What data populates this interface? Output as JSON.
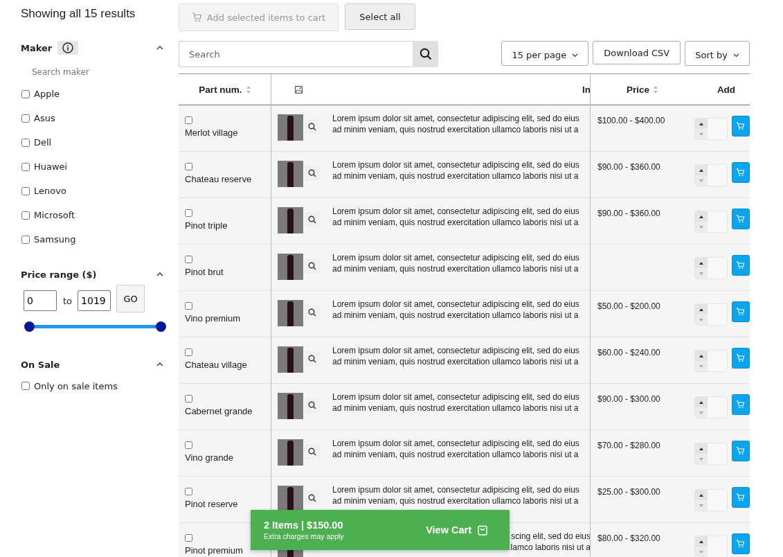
{
  "sidebar": {
    "results_title": "Showing all 15 results",
    "maker": {
      "title": "Maker",
      "expanded": true,
      "search": {
        "placeholder": "Search maker"
      },
      "options": [
        {
          "label": "Apple",
          "checked": false
        },
        {
          "label": "Asus",
          "checked": false
        },
        {
          "label": "Dell",
          "checked": false
        },
        {
          "label": "Huawei",
          "checked": false
        },
        {
          "label": "Lenovo",
          "checked": false
        },
        {
          "label": "Microsoft",
          "checked": false
        },
        {
          "label": "Samsung",
          "checked": false
        }
      ]
    },
    "price_range": {
      "title": "Price range ($)",
      "expanded": true,
      "min": "0",
      "to": "to",
      "max": "1019",
      "go": "GO",
      "thumbs": [
        {
          "level": 0
        },
        {
          "level": 1
        }
      ]
    },
    "on_sale": {
      "title": "On Sale",
      "expanded": true,
      "option": {
        "label": "Only on sale items",
        "checked": false
      }
    }
  },
  "toolbar": {
    "add_selected": {
      "label": "Add selected items to cart",
      "disabled": true
    },
    "select_all": "Select all",
    "search": {
      "placeholder": "Search"
    },
    "per_page": "15 per page",
    "download": "Download CSV",
    "sort": "Sort by"
  },
  "table": {
    "columns": [
      "Part num.",
      "",
      "In",
      "Price",
      "Add"
    ],
    "rows": [
      {
        "name": "Merlot village",
        "checked": false,
        "line1": "Lorem ipsum dolor sit amet, consectetur adipiscing elit, sed do eius",
        "line2": "ad minim veniam, quis nostrud exercitation ullamco laboris nisi ut a",
        "price": "$100.00 -  $400.00",
        "covered": false
      },
      {
        "name": "Chateau reserve",
        "checked": false,
        "line1": "Lorem ipsum dolor sit amet, consectetur adipiscing elit, sed do eius",
        "line2": "ad minim veniam, quis nostrud exercitation ullamco laboris nisi ut a",
        "price": "$90.00 -  $360.00",
        "covered": false
      },
      {
        "name": "Pinot triple",
        "checked": false,
        "line1": "Lorem ipsum dolor sit amet, consectetur adipiscing elit, sed do eius",
        "line2": "ad minim veniam, quis nostrud exercitation ullamco laboris nisi ut a",
        "price": "$90.00 -  $360.00",
        "covered": false
      },
      {
        "name": "Pinot brut",
        "checked": false,
        "line1": "Lorem ipsum dolor sit amet, consectetur adipiscing elit, sed do eius",
        "line2": "ad minim veniam, quis nostrud exercitation ullamco laboris nisi ut a",
        "covered": false
      },
      {
        "name": "Vino premium",
        "checked": false,
        "line1": "Lorem ipsum dolor sit amet, consectetur adipiscing elit, sed do eius",
        "line2": "ad minim veniam, quis nostrud exercitation ullamco laboris nisi ut a",
        "price": "$50.00 -  $200.00",
        "covered": false
      },
      {
        "name": "Chateau village",
        "checked": false,
        "line1": "Lorem ipsum dolor sit amet, consectetur adipiscing elit, sed do eius",
        "line2": "ad minim veniam, quis nostrud exercitation ullamco laboris nisi ut a",
        "price": "$60.00 -  $240.00",
        "covered": false
      },
      {
        "name": "Cabernet grande",
        "checked": false,
        "line1": "Lorem ipsum dolor sit amet, consectetur adipiscing elit, sed do eius",
        "line2": "ad minim veniam, quis nostrud exercitation ullamco laboris nisi ut a",
        "price": "$90.00 -  $300.00",
        "covered": false
      },
      {
        "name": "Vino grande",
        "checked": false,
        "line1": "Lorem ipsum dolor sit amet, consectetur adipiscing elit, sed do eius",
        "line2": "ad minim veniam, quis nostrud exercitation ullamco laboris nisi ut a",
        "price": "$70.00 -  $280.00",
        "covered": false
      },
      {
        "name": "Pinot reserve",
        "checked": false,
        "line1": "Lorem ipsum dolor sit amet, consectetur adipiscing elit, sed do eius",
        "line2": "ad minim veniam, quis nostrud exercitation ullamco laboris nisi ut a",
        "price": "$25.00 -  $300.00",
        "covered": false
      },
      {
        "name": "Pinot premium",
        "checked": false,
        "line1": "scing elit, sed do eius",
        "line2": "lamco laboris nisi ut a",
        "price": "$80.00 -  $320.00",
        "covered": true
      }
    ]
  },
  "cart_bar": {
    "summary": "2 Items | $150.00",
    "note": "Extra charges may apply",
    "action": "View Cart"
  }
}
